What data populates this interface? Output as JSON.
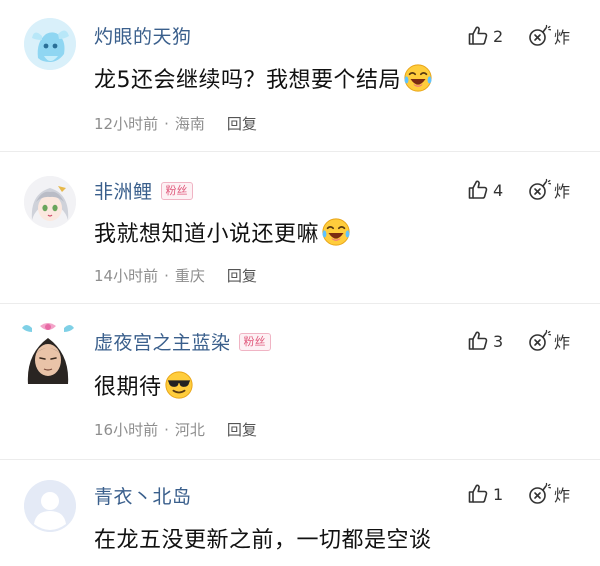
{
  "comments": [
    {
      "username": "灼眼的天狗",
      "badge": "",
      "text": "龙5还会继续吗？我想要个结局",
      "emoji": "laughing-crying-emoji",
      "time": "12小时前",
      "location": "海南",
      "reply_label": "回复",
      "like_count": "2",
      "bomb_label": "炸",
      "avatar": "blue-fantasy-creature-avatar"
    },
    {
      "username": "非洲鲤",
      "badge": "粉丝",
      "text": "我就想知道小说还更嘛",
      "emoji": "laughing-crying-emoji",
      "time": "14小时前",
      "location": "重庆",
      "reply_label": "回复",
      "like_count": "4",
      "bomb_label": "炸",
      "avatar": "anime-girl-avatar"
    },
    {
      "username": "虚夜宫之主蓝染",
      "badge": "粉丝",
      "text": "很期待",
      "emoji": "sunglasses-emoji",
      "time": "16小时前",
      "location": "河北",
      "reply_label": "回复",
      "like_count": "3",
      "bomb_label": "炸",
      "avatar": "anime-man-with-bow-avatar"
    },
    {
      "username": "青衣丶北岛",
      "badge": "",
      "text": "在龙五没更新之前，一切都是空谈",
      "emoji": "",
      "time": "",
      "location": "",
      "reply_label": "",
      "like_count": "1",
      "bomb_label": "炸",
      "avatar": "default-user-avatar"
    }
  ],
  "colors": {
    "username": "#3a5f8c",
    "badge": "#e0577a",
    "meta": "#8e8e8e"
  }
}
